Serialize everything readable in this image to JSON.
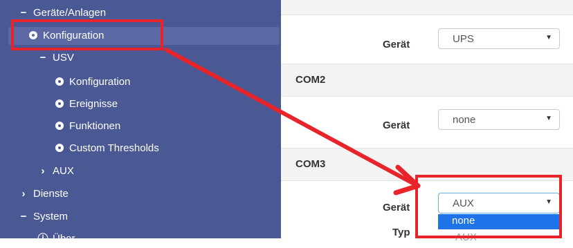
{
  "sidebar": {
    "items": [
      {
        "label": "Geräte/Anlagen",
        "icon": "minus-icon"
      },
      {
        "label": "Konfiguration",
        "icon": "gear-icon",
        "active": true
      },
      {
        "label": "USV",
        "icon": "minus-icon"
      },
      {
        "label": "Konfiguration",
        "icon": "gear-icon"
      },
      {
        "label": "Ereignisse",
        "icon": "gear-icon"
      },
      {
        "label": "Funktionen",
        "icon": "gear-icon"
      },
      {
        "label": "Custom Thresholds",
        "icon": "gear-icon"
      },
      {
        "label": "AUX",
        "icon": "chevron-right-icon"
      },
      {
        "label": "Dienste",
        "icon": "chevron-right-icon"
      },
      {
        "label": "System",
        "icon": "minus-icon"
      },
      {
        "label": "Über",
        "icon": "info-icon"
      }
    ]
  },
  "main": {
    "com1": {
      "label": "Gerät",
      "value": "UPS"
    },
    "com2": {
      "header": "COM2",
      "label": "Gerät",
      "value": "none"
    },
    "com3": {
      "header": "COM3",
      "label": "Gerät",
      "value": "AUX",
      "dropdown_option": "none",
      "type_label": "Typ",
      "type_value_partial": "AUX"
    }
  },
  "colors": {
    "sidebar_bg": "#4a5893",
    "active_bg": "#5b68a3",
    "highlight_red": "#e8232a",
    "option_blue": "#1e73e8"
  }
}
